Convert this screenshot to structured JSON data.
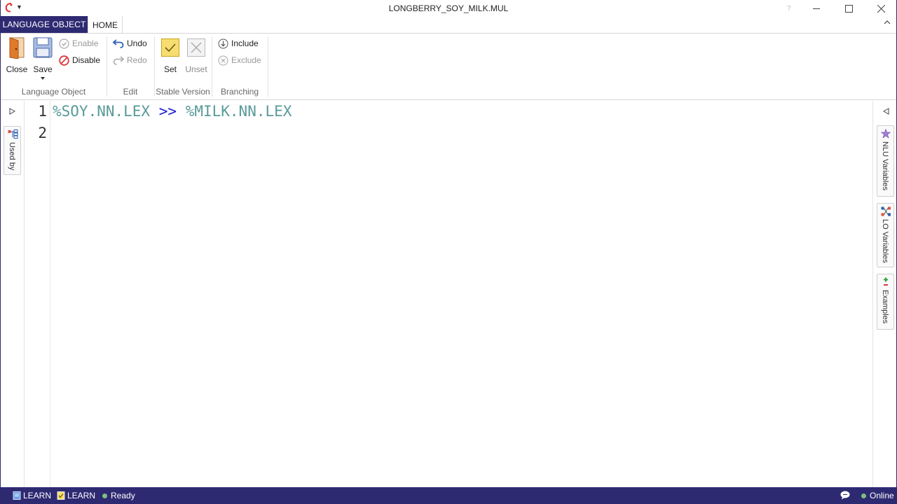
{
  "window": {
    "title": "LONGBERRY_SOY_MILK.MUL",
    "help_glyph": "?"
  },
  "tabs": [
    {
      "label": "LANGUAGE OBJECT",
      "active": false
    },
    {
      "label": "HOME",
      "active": true
    }
  ],
  "ribbon": {
    "groups": {
      "language_object": "Language Object",
      "edit": "Edit",
      "stable_version": "Stable Version",
      "branching": "Branching"
    },
    "buttons": {
      "close": "Close",
      "save": "Save",
      "enable": "Enable",
      "disable": "Disable",
      "undo": "Undo",
      "redo": "Redo",
      "set": "Set",
      "unset": "Unset",
      "include": "Include",
      "exclude": "Exclude"
    }
  },
  "left_panel": {
    "tabs": [
      {
        "label": "Used by",
        "icon": "hierarchy-icon"
      }
    ]
  },
  "right_panel": {
    "tabs": [
      {
        "label": "NLU Variables",
        "icon": "gear-star-icon"
      },
      {
        "label": "LO Variables",
        "icon": "network-icon"
      },
      {
        "label": "Examples",
        "icon": "plus-minus-icon"
      }
    ]
  },
  "editor": {
    "line_numbers": [
      "1",
      "2"
    ],
    "lines": [
      {
        "tokens": [
          "%SOY.NN.LEX",
          " ",
          ">>",
          " ",
          "%MILK.NN.LEX"
        ]
      },
      {
        "tokens": []
      }
    ]
  },
  "statusbar": {
    "learn_1": "LEARN",
    "learn_2": "LEARN",
    "ready": "Ready",
    "online": "Online"
  },
  "colors": {
    "brand": "#2e2a72",
    "variable_token": "#5a9a9a",
    "operator_token": "#1f1fd0",
    "online_dot": "#7fbf7f"
  }
}
